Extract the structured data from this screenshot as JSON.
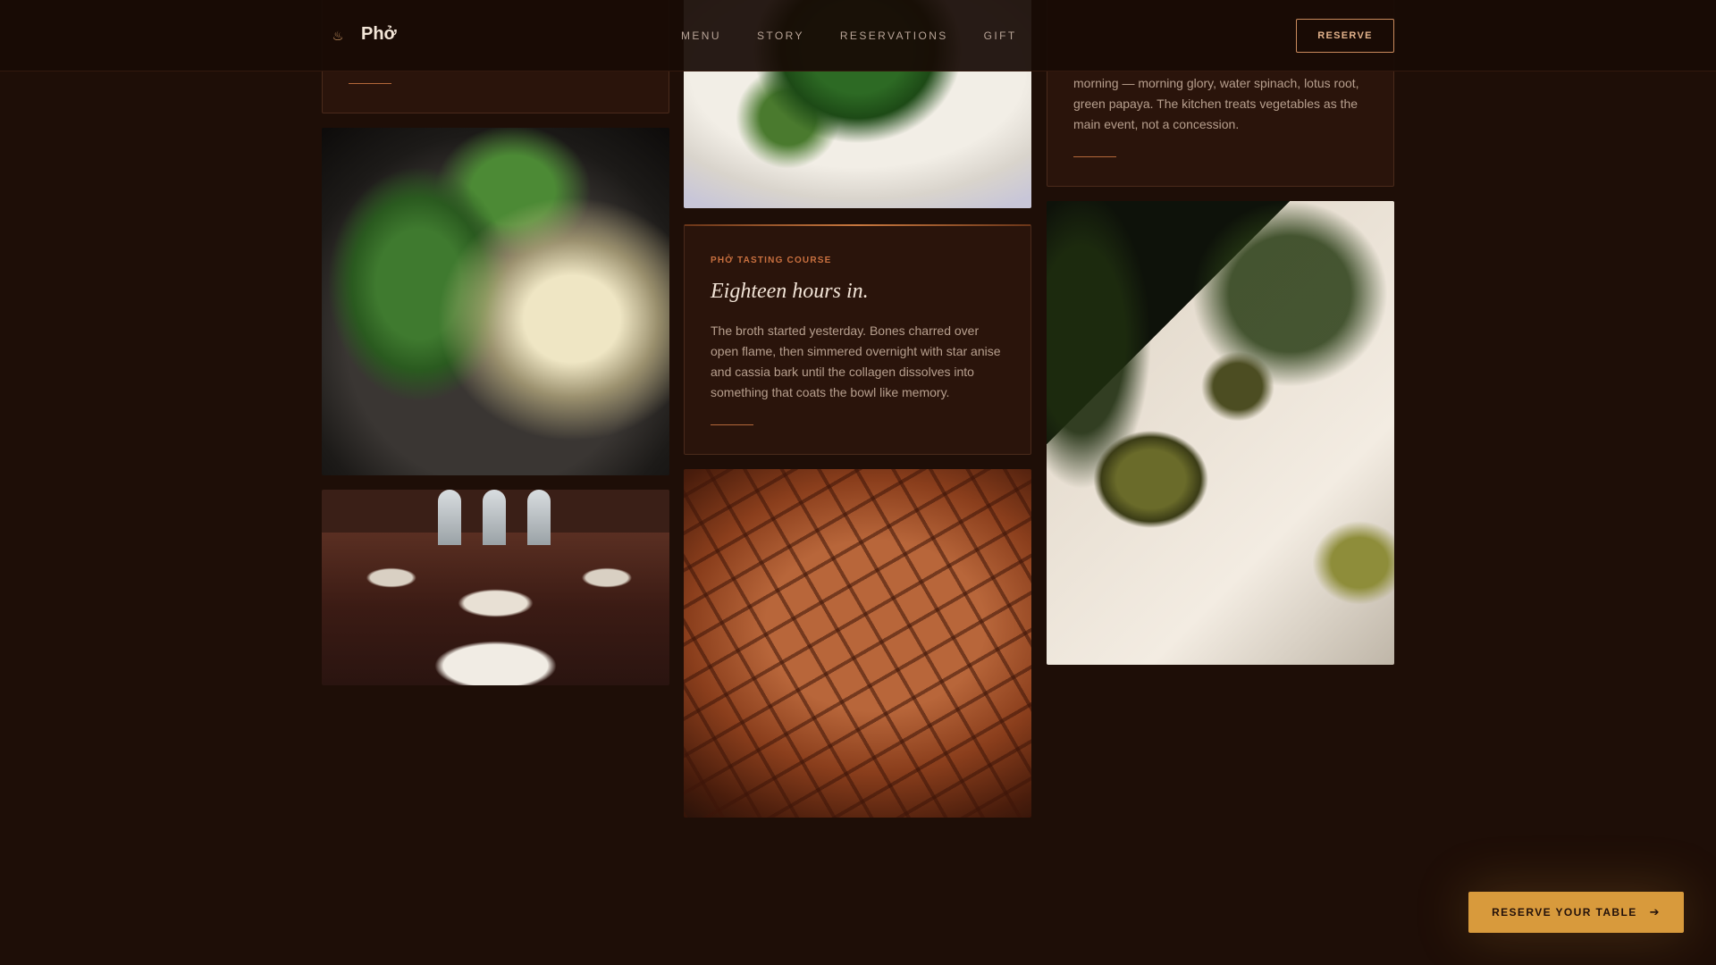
{
  "brand": {
    "name": "Phở",
    "icon": "bowl-icon"
  },
  "nav": {
    "items": [
      "MENU",
      "STORY",
      "RESERVATIONS",
      "GIFT"
    ],
    "reserve_label": "RESERVE"
  },
  "cards": {
    "vegetables": {
      "text": "morning — morning glory, water spinach, lotus root, green papaya. The kitchen treats vegetables as the main event, not a concession."
    },
    "tasting": {
      "kicker": "PHỞ TASTING COURSE",
      "title": "Eighteen hours in.",
      "text": "The broth started yesterday. Bones charred over open flame, then simmered overnight with star anise and cassia bark until the collagen dissolves into something that coats the bowl like memory."
    }
  },
  "cta": {
    "label": "RESERVE YOUR TABLE",
    "icon": "arrow-right-icon"
  },
  "colors": {
    "background": "#1e0e07",
    "card": "#2a140b",
    "accent": "#d89a3c",
    "kicker": "#c9703f"
  }
}
